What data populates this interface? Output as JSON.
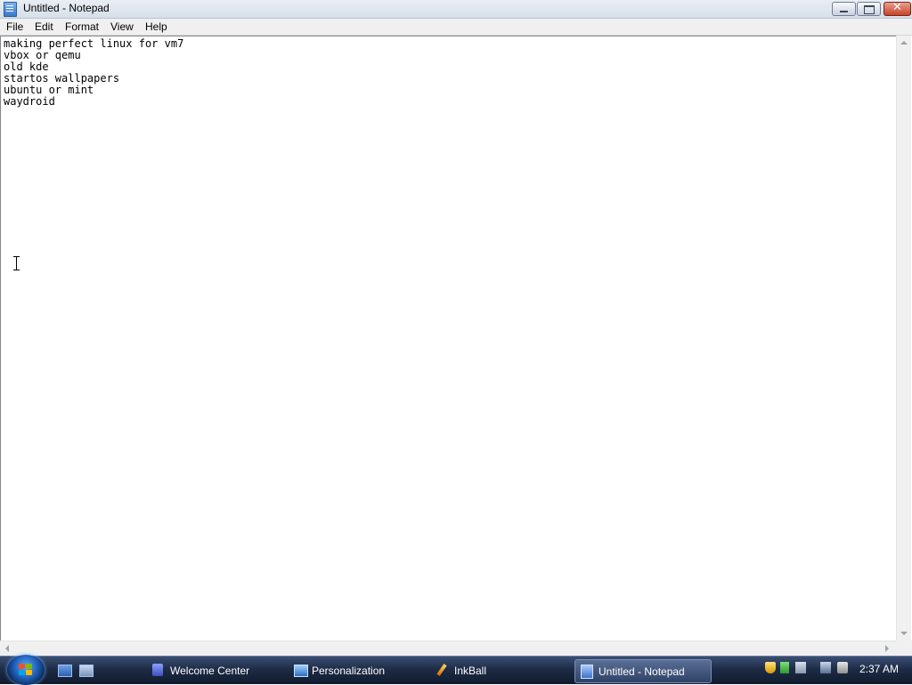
{
  "window": {
    "title": "Untitled - Notepad",
    "close_glyph": "✕"
  },
  "menu": {
    "file": "File",
    "edit": "Edit",
    "format": "Format",
    "view": "View",
    "help": "Help"
  },
  "editor": {
    "text": "making perfect linux for vm7\nvbox or qemu\nold kde\nstartos wallpapers\nubuntu or mint\nwaydroid"
  },
  "taskbar": {
    "tasks": [
      {
        "label": "Welcome Center",
        "icon": "welcome-center-icon"
      },
      {
        "label": "Personalization",
        "icon": "personalization-icon"
      },
      {
        "label": "InkBall",
        "icon": "inkball-icon"
      },
      {
        "label": "Untitled - Notepad",
        "icon": "notepad-icon",
        "active": true
      }
    ],
    "clock": "2:37 AM"
  }
}
